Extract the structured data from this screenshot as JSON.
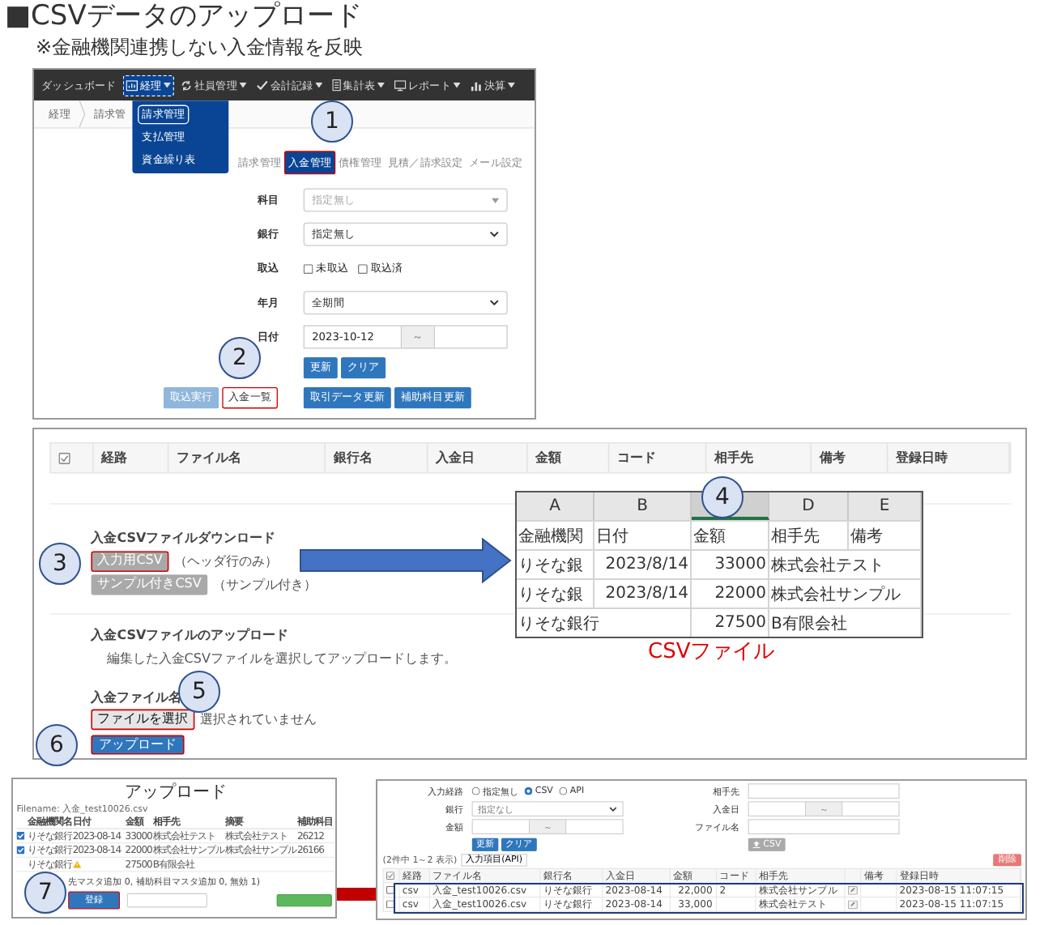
{
  "title": "■CSVデータのアップロード",
  "note": "※金融機関連携しない入金情報を反映",
  "menu_screen": {
    "nav": [
      {
        "label": "ダッシュボード",
        "caret": false,
        "selected": false
      },
      {
        "label": "経理",
        "caret": true,
        "selected": true
      },
      {
        "label": "社員管理",
        "caret": true,
        "selected": false
      },
      {
        "label": "会計記録",
        "caret": true,
        "selected": false
      },
      {
        "label": "集計表",
        "caret": true,
        "selected": false
      },
      {
        "label": "レポート",
        "caret": true,
        "selected": false
      },
      {
        "label": "決算",
        "caret": true,
        "selected": false
      }
    ],
    "dropdown": [
      {
        "label": "請求管理",
        "selected": true
      },
      {
        "label": "支払管理",
        "selected": false
      },
      {
        "label": "資金繰り表",
        "selected": false
      }
    ],
    "breadcrumb": [
      "経理",
      "請求管"
    ],
    "tabs": [
      {
        "label": "請求管理",
        "selected": false
      },
      {
        "label": "入金管理",
        "selected": true
      },
      {
        "label": "債権管理",
        "selected": false
      },
      {
        "label": "見積／請求設定",
        "selected": false
      },
      {
        "label": "メール設定",
        "selected": false
      }
    ],
    "form": [
      {
        "kind": "select",
        "label": "科目",
        "value": "指定無し",
        "disabled": true
      },
      {
        "kind": "select",
        "label": "銀行",
        "value": "指定無し",
        "disabled": false
      },
      {
        "kind": "checks",
        "label": "取込",
        "options": [
          {
            "label": "未取込",
            "checked": false
          },
          {
            "label": "取込済",
            "checked": false
          }
        ]
      },
      {
        "kind": "select",
        "label": "年月",
        "value": "全期間",
        "disabled": false
      },
      {
        "kind": "range",
        "label": "日付",
        "from": "2023-10-12",
        "separator": "～"
      }
    ],
    "buttons": [
      "更新",
      "クリア"
    ],
    "actions": [
      {
        "label": "取込実行",
        "kind": "light",
        "highlighted": false
      },
      {
        "label": "入金一覧",
        "kind": "plain",
        "highlighted": true
      },
      {
        "label": "取引データ更新",
        "kind": "primary",
        "highlighted": false
      },
      {
        "label": "補助科目更新",
        "kind": "primary",
        "highlighted": false
      }
    ]
  },
  "csv_screen": {
    "columns": [
      "経路",
      "ファイル名",
      "銀行名",
      "入金日",
      "金額",
      "コード",
      "相手先",
      "備考",
      "登録日時"
    ],
    "download": {
      "heading": "入金CSVファイルダウンロード",
      "buttons": [
        {
          "label": "入力用CSV",
          "note": "（ヘッダ行のみ）",
          "highlighted": true
        },
        {
          "label": "サンプル付きCSV",
          "note": "（サンプル付き）",
          "highlighted": false
        }
      ]
    },
    "upload": {
      "heading": "入金CSVファイルのアップロード",
      "description": "編集した入金CSVファイルを選択してアップロードします。",
      "file_label": "入金ファイル名",
      "file_button": {
        "label": "ファイルを選択",
        "highlighted": true
      },
      "file_status": "選択されていません",
      "submit": {
        "label": "アップロード",
        "highlighted": true
      }
    }
  },
  "spreadsheet": {
    "overlay_label": "CSVファイル",
    "columns": [
      {
        "label": "A",
        "selected": false
      },
      {
        "label": "B",
        "selected": false,
        "numeric": true
      },
      {
        "selected": true,
        "numeric": true
      },
      {
        "label": "D",
        "selected": false
      },
      {
        "label": "E",
        "selected": false
      }
    ],
    "rows": [
      {
        "kind": "header",
        "cells": [
          "金融機関",
          "日付",
          "金額",
          "相手先",
          "備考"
        ]
      },
      {
        "kind": "data",
        "cells": [
          "りそな銀",
          "2023/8/14",
          "33000",
          "株式会社テスト",
          null
        ]
      },
      {
        "kind": "data",
        "cells": [
          "りそな銀",
          "2023/8/14",
          "22000",
          "株式会社サンプル",
          null
        ]
      },
      {
        "kind": "data",
        "cells": [
          "りそな銀行",
          null,
          "27500",
          "B有限会社",
          null
        ]
      }
    ]
  },
  "upload_dialog": {
    "title": "アップロード",
    "filename": "Filename: 入金_test10026.csv",
    "columns": [
      "金融機関名",
      "日付",
      "金額",
      "相手先",
      "摘要",
      "補助科目"
    ],
    "rows": [
      {
        "kind": "valid",
        "checked": true,
        "cells": [
          "りそな銀行",
          "2023-08-14",
          "33000",
          "株式会社テスト",
          "株式会社テスト",
          "26212"
        ]
      },
      {
        "kind": "valid",
        "checked": true,
        "cells": [
          "りそな銀行",
          "2023-08-14",
          "22000",
          "株式会社サンプル",
          "株式会社サンプル",
          "26166"
        ]
      },
      {
        "kind": "invalid",
        "cells": [
          "りそな銀行",
          null,
          "27500",
          "B有限会社",
          null,
          null
        ]
      }
    ],
    "summary": "先マスタ追加 0, 補助科目マスタ追加 0, 無効 1)",
    "submit": {
      "label": "登録",
      "highlighted": true
    }
  },
  "list_screen": {
    "filters": [
      {
        "kind": "radios",
        "label": "入力経路",
        "options": [
          {
            "label": "指定無し",
            "selected": false
          },
          {
            "label": "CSV",
            "selected": true
          },
          {
            "label": "API",
            "selected": false
          }
        ]
      },
      {
        "kind": "text",
        "label": "相手先"
      },
      {
        "kind": "select",
        "label": "銀行",
        "value": "指定なし"
      },
      {
        "kind": "range",
        "label": "入金日",
        "separator": "～"
      },
      {
        "kind": "range",
        "label": "金額",
        "separator": "～"
      },
      {
        "kind": "text",
        "label": "ファイル名"
      }
    ],
    "buttons": [
      "更新",
      "クリア"
    ],
    "csv_button": "CSV",
    "count": "(2件中 1～2 表示)",
    "column_button": "入力項目(API)",
    "delete_button": "削除",
    "columns": [
      "経路",
      "ファイル名",
      "銀行名",
      "入金日",
      "金額",
      "コード",
      "相手先",
      "備考",
      "登録日時"
    ],
    "rows": [
      {
        "checked": false,
        "cells": [
          "csv",
          "入金_test10026.csv",
          "りそな銀行",
          "2023-08-14",
          "22,000",
          "2",
          "株式会社サンプル",
          null,
          "2023-08-15 11:07:15"
        ]
      },
      {
        "checked": false,
        "cells": [
          "csv",
          "入金_test10026.csv",
          "りそな銀行",
          "2023-08-14",
          "33,000",
          null,
          "株式会社テスト",
          null,
          "2023-08-15 11:07:15"
        ]
      }
    ]
  },
  "callouts": [
    {
      "number": "1"
    },
    {
      "number": "2"
    },
    {
      "number": "3"
    },
    {
      "number": "4"
    },
    {
      "number": "5"
    },
    {
      "number": "6"
    },
    {
      "number": "7"
    }
  ]
}
